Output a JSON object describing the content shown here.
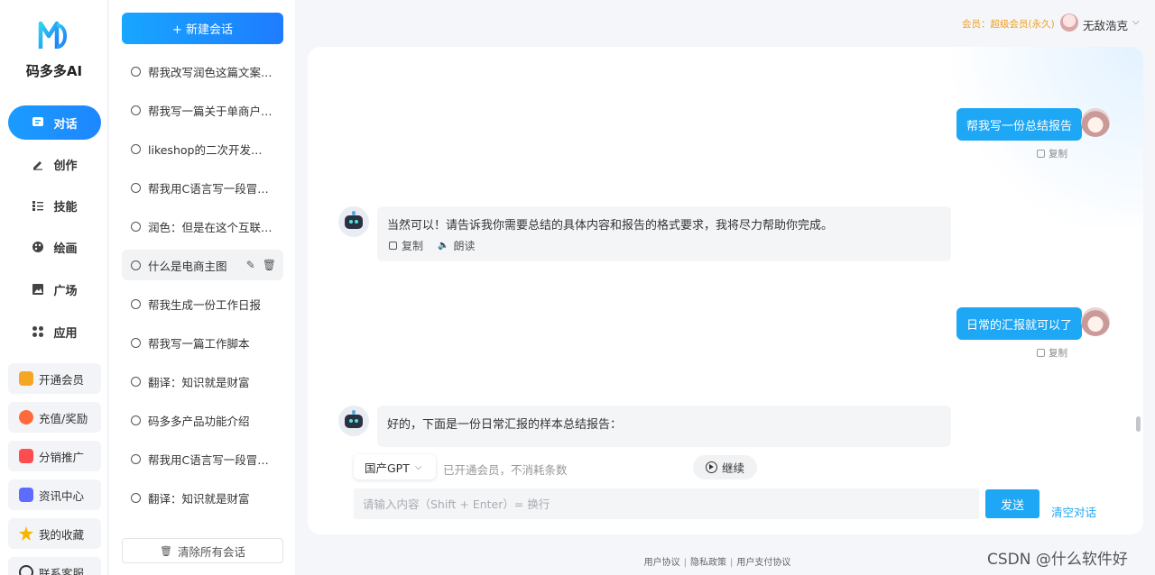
{
  "nav": {
    "brand": "码多多AI",
    "items": [
      {
        "label": "对话",
        "icon": "chat-icon"
      },
      {
        "label": "创作",
        "icon": "pen-icon"
      },
      {
        "label": "技能",
        "icon": "list-icon"
      },
      {
        "label": "绘画",
        "icon": "palette-icon"
      },
      {
        "label": "广场",
        "icon": "image-icon"
      },
      {
        "label": "应用",
        "icon": "apps-icon"
      }
    ],
    "features": [
      {
        "label": "开通会员",
        "icon": "vip-icon",
        "color": "#f5a623"
      },
      {
        "label": "充值/奖励",
        "icon": "recharge-icon",
        "color": "#ff6a3d"
      },
      {
        "label": "分销推广",
        "icon": "distribution-icon",
        "color": "#ff4d4f"
      },
      {
        "label": "资讯中心",
        "icon": "news-icon",
        "color": "#5b6cff"
      },
      {
        "label": "我的收藏",
        "icon": "star-icon",
        "color": "#f7b500"
      },
      {
        "label": "联系客服",
        "icon": "service-icon",
        "color": "#333333"
      }
    ]
  },
  "sessions": {
    "new_label": "+ 新建会话",
    "items": [
      "帮我改写润色这篇文案\"双十一是每个商家都期待的节日\"",
      "帮我写一篇关于单商户商城的介绍",
      "likeshop的二次开发是什么",
      "帮我用C语言写一段冒泡排序",
      "润色：但是在这个互联网时代",
      "什么是电商主图",
      "帮我生成一份工作日报",
      "帮我写一篇工作脚本",
      "翻译：知识就是财富",
      "码多多产品功能介绍",
      "帮我用C语言写一段冒泡排序",
      "翻译：知识就是财富"
    ],
    "active_index": 5,
    "clear_all_label": "清除所有会话"
  },
  "header": {
    "member_text": "会员：超级会员(永久)",
    "user_name": "无敌浩克"
  },
  "chat": {
    "messages": [
      {
        "role": "user",
        "text": "帮我写一份总结报告",
        "copy_label": "复制"
      },
      {
        "role": "assistant",
        "text": "当然可以！请告诉我你需要总结的具体内容和报告的格式要求，我将尽力帮助你完成。",
        "copy_label": "复制",
        "read_label": "朗读"
      },
      {
        "role": "user",
        "text": "日常的汇报就可以了",
        "copy_label": "复制"
      },
      {
        "role": "assistant",
        "text": "好的，下面是一份日常汇报的样本总结报告："
      }
    ],
    "model_label": "国产GPT",
    "quota_text": "已开通会员，不消耗条数",
    "continue_label": "继续",
    "input_placeholder": "请输入内容（Shift + Enter）= 换行",
    "send_label": "发送",
    "clear_label": "清空对话"
  },
  "footer": {
    "links": [
      "用户协议",
      "隐私政策",
      "用户支付协议"
    ]
  },
  "watermark": "CSDN @什么软件好"
}
